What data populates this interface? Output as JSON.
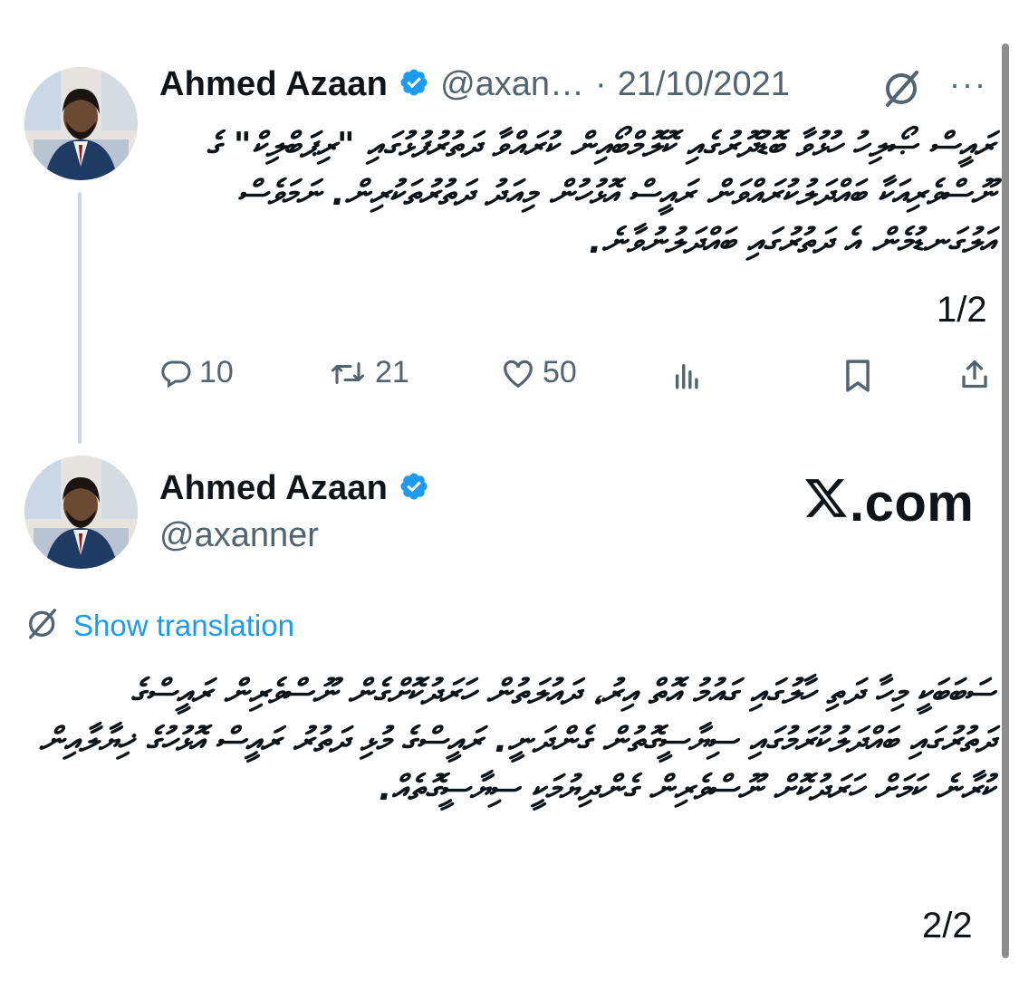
{
  "tweet1": {
    "author_name": "Ahmed Azaan",
    "handle": "@axan…",
    "separator": "·",
    "date": "21/10/2021",
    "more": "···",
    "body": "ރައީސް ޞޯލިހު ހުޅުވާ ބޮޑުދޮރުގެއި ކޮލޮމްބޯއިން ކުރައްވާ ދަތުރުފުޅުގައި \"ރިޕަބްލިކް\" ގެ ނޫސްވެރިއަކާ ބައްދަލުކުރައްވަން ރައީސް އޮޅުހުން މިއަދު ދަތުރުތަކުރިން. ނަމަވެސް އަލުގަނޑުމެން އެ ދަތުރުގައި ބައްދަލުނުވާނެ.",
    "pager": "1/2",
    "replies": "10",
    "reposts": "21",
    "likes": "50"
  },
  "tweet2": {
    "author_name": "Ahmed Azaan",
    "handle": "@axanner",
    "show_translation": "Show translation",
    "body": "ސަބަބަކީ މިހާ ދަތި ހާލުގައި ގައުމު އޮތް އިރު، ދައުލަތުން ހަރަދުކޮށްގެން ނޫސްވެރިން ރައީސްގެ ދަތުރުގައި ބައްދަލުކުރަމުގައި ސިޔާސީގޮތުން ގެންދަނީ. ރައީސްގެ މުޅި ދަތުރު ރައީސް އޮޅުހުގެ ޚިޔާލާއިން ކުރާނެ ކަމަށް ހަރަދުކޮށް ނޫސްވެރިން ގެންދިޔުމަކީ ސިޔާސީގޮތެއް.",
    "pager": "2/2"
  },
  "watermark": {
    "text": ".com",
    "logo": "X"
  },
  "icons": {
    "verified": "verified-badge-icon",
    "translate": "translate-icon",
    "more": "more-icon",
    "reply": "reply-icon",
    "repost": "repost-icon",
    "like": "like-icon",
    "views": "views-icon",
    "bookmark": "bookmark-icon",
    "share": "share-icon"
  },
  "colors": {
    "verified": "#1d9bf0",
    "link": "#1d9bf0",
    "muted": "#536471",
    "text": "#0f1419",
    "thread_line": "#cfd9de"
  }
}
